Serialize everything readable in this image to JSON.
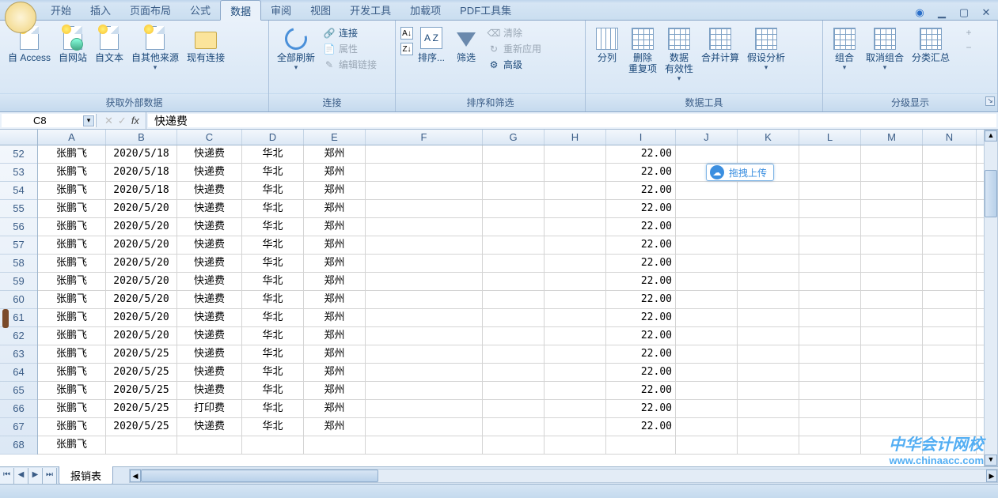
{
  "tabs": {
    "items": [
      "开始",
      "插入",
      "页面布局",
      "公式",
      "数据",
      "审阅",
      "视图",
      "开发工具",
      "加载项",
      "PDF工具集"
    ],
    "active": 4
  },
  "ribbon": {
    "g1": {
      "label": "获取外部数据",
      "btns": [
        "自 Access",
        "自网站",
        "自文本",
        "自其他来源",
        "现有连接"
      ]
    },
    "g2": {
      "label": "连接",
      "main": "全部刷新",
      "side": [
        "连接",
        "属性",
        "编辑链接"
      ]
    },
    "g3": {
      "label": "排序和筛选",
      "sort": "排序...",
      "filter": "筛选",
      "side": [
        "清除",
        "重新应用",
        "高级"
      ]
    },
    "g4": {
      "label": "数据工具",
      "btns": [
        "分列",
        "删除\n重复项",
        "数据\n有效性",
        "合并计算",
        "假设分析"
      ]
    },
    "g5": {
      "label": "分级显示",
      "btns": [
        "组合",
        "取消组合",
        "分类汇总"
      ]
    }
  },
  "formula": {
    "nameBox": "C8",
    "fx": "fx",
    "value": "快递费"
  },
  "columns": [
    "A",
    "B",
    "C",
    "D",
    "E",
    "F",
    "G",
    "H",
    "I",
    "J",
    "K",
    "L",
    "M",
    "N"
  ],
  "rowStart": 52,
  "rowCount": 17,
  "data": [
    [
      "张鹏飞",
      "2020/5/18",
      "快递费",
      "华北",
      "郑州",
      "",
      "",
      "",
      "22.00"
    ],
    [
      "张鹏飞",
      "2020/5/18",
      "快递费",
      "华北",
      "郑州",
      "",
      "",
      "",
      "22.00"
    ],
    [
      "张鹏飞",
      "2020/5/18",
      "快递费",
      "华北",
      "郑州",
      "",
      "",
      "",
      "22.00"
    ],
    [
      "张鹏飞",
      "2020/5/20",
      "快递费",
      "华北",
      "郑州",
      "",
      "",
      "",
      "22.00"
    ],
    [
      "张鹏飞",
      "2020/5/20",
      "快递费",
      "华北",
      "郑州",
      "",
      "",
      "",
      "22.00"
    ],
    [
      "张鹏飞",
      "2020/5/20",
      "快递费",
      "华北",
      "郑州",
      "",
      "",
      "",
      "22.00"
    ],
    [
      "张鹏飞",
      "2020/5/20",
      "快递费",
      "华北",
      "郑州",
      "",
      "",
      "",
      "22.00"
    ],
    [
      "张鹏飞",
      "2020/5/20",
      "快递费",
      "华北",
      "郑州",
      "",
      "",
      "",
      "22.00"
    ],
    [
      "张鹏飞",
      "2020/5/20",
      "快递费",
      "华北",
      "郑州",
      "",
      "",
      "",
      "22.00"
    ],
    [
      "张鹏飞",
      "2020/5/20",
      "快递费",
      "华北",
      "郑州",
      "",
      "",
      "",
      "22.00"
    ],
    [
      "张鹏飞",
      "2020/5/20",
      "快递费",
      "华北",
      "郑州",
      "",
      "",
      "",
      "22.00"
    ],
    [
      "张鹏飞",
      "2020/5/25",
      "快递费",
      "华北",
      "郑州",
      "",
      "",
      "",
      "22.00"
    ],
    [
      "张鹏飞",
      "2020/5/25",
      "快递费",
      "华北",
      "郑州",
      "",
      "",
      "",
      "22.00"
    ],
    [
      "张鹏飞",
      "2020/5/25",
      "快递费",
      "华北",
      "郑州",
      "",
      "",
      "",
      "22.00"
    ],
    [
      "张鹏飞",
      "2020/5/25",
      "打印费",
      "华北",
      "郑州",
      "",
      "",
      "",
      "22.00"
    ],
    [
      "张鹏飞",
      "2020/5/25",
      "快递费",
      "华北",
      "郑州",
      "",
      "",
      "",
      "22.00"
    ],
    [
      "张鹏飞",
      "",
      "",
      "",
      "",
      "",
      "",
      "",
      ""
    ]
  ],
  "sheetTab": "报销表",
  "floatBadge": "拖拽上传",
  "watermark": {
    "l1": "中华会计网校",
    "l2": "www.chinaacc.com"
  }
}
